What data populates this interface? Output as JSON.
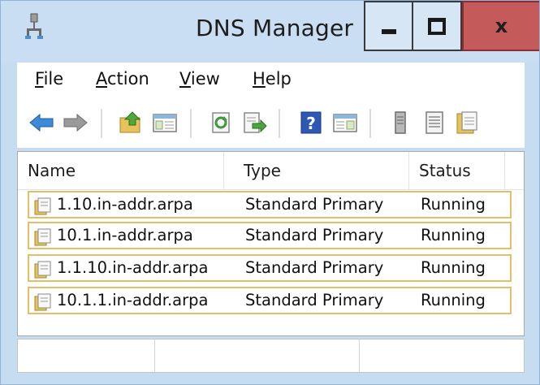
{
  "window": {
    "title": "DNS Manager",
    "icons": {
      "app": "dns-server-icon"
    },
    "controls": {
      "minimize_icon": "minimize-icon",
      "maximize_icon": "maximize-icon",
      "close_glyph": "x"
    }
  },
  "menu": {
    "items": [
      {
        "label": "File",
        "accel": "F",
        "rest": "ile"
      },
      {
        "label": "Action",
        "accel": "A",
        "rest": "ction"
      },
      {
        "label": "View",
        "accel": "V",
        "rest": "iew"
      },
      {
        "label": "Help",
        "accel": "H",
        "rest": "elp"
      }
    ]
  },
  "toolbar": {
    "buttons": [
      "back-arrow-icon",
      "forward-arrow-icon",
      "up-folder-icon",
      "show-hide-console-tree-icon",
      "refresh-icon",
      "export-list-icon",
      "help-icon",
      "show-hide-action-pane-icon",
      "server-icon",
      "properties-list-icon",
      "zone-icon"
    ]
  },
  "list": {
    "columns": [
      "Name",
      "Type",
      "Status"
    ],
    "rows": [
      {
        "name": "1.10.in-addr.arpa",
        "type": "Standard Primary",
        "status": "Running"
      },
      {
        "name": "10.1.in-addr.arpa",
        "type": "Standard Primary",
        "status": "Running"
      },
      {
        "name": "1.1.10.in-addr.arpa",
        "type": "Standard Primary",
        "status": "Running"
      },
      {
        "name": "10.1.1.in-addr.arpa",
        "type": "Standard Primary",
        "status": "Running"
      }
    ],
    "row_icon": "zone-file-icon"
  },
  "colors": {
    "title_bar": "#c9def2",
    "close_button": "#c55a5a",
    "row_highlight_border": "#e3c067"
  }
}
